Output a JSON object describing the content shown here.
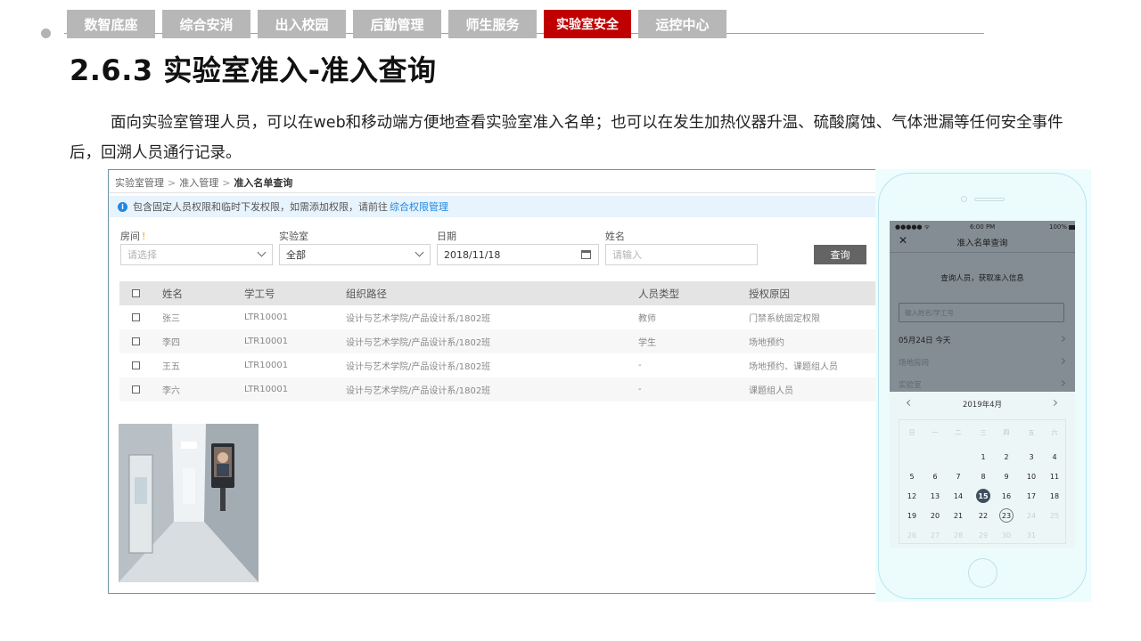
{
  "nav": {
    "tabs": [
      {
        "label": "数智底座"
      },
      {
        "label": "综合安消"
      },
      {
        "label": "出入校园"
      },
      {
        "label": "后勤管理"
      },
      {
        "label": "师生服务"
      },
      {
        "label": "实验室安全"
      },
      {
        "label": "运控中心"
      }
    ],
    "active_index": 5,
    "active_color": "#c00000",
    "tab_color": "#b7b7b7"
  },
  "slide": {
    "title": "2.6.3 实验室准入-准入查询",
    "description": "面向实验室管理人员，可以在web和移动端方便地查看实验室准入名单；也可以在发生加热仪器升温、硫酸腐蚀、气体泄漏等任何安全事件后，回溯人员通行记录。"
  },
  "desktop": {
    "breadcrumb": [
      "实验室管理",
      "准入管理",
      "准入名单查询"
    ],
    "notice": {
      "text": "包含固定人员权限和临时下发权限，如需添加权限，请前往",
      "link": "综合权限管理"
    },
    "filters": {
      "room": {
        "label": "房间",
        "placeholder": "请选择"
      },
      "lab": {
        "label": "实验室",
        "value": "全部"
      },
      "date": {
        "label": "日期",
        "value": "2018/11/18"
      },
      "name": {
        "label": "姓名",
        "placeholder": "请输入"
      }
    },
    "query_button": "查询",
    "table": {
      "columns": [
        "姓名",
        "学工号",
        "组织路径",
        "人员类型",
        "授权原因"
      ],
      "rows": [
        {
          "name": "张三",
          "id": "LTR10001",
          "org": "设计与艺术学院/产品设计系/1802班",
          "type": "教师",
          "reason": "门禁系统固定权限"
        },
        {
          "name": "李四",
          "id": "LTR10001",
          "org": "设计与艺术学院/产品设计系/1802班",
          "type": "学生",
          "reason": "场地预约"
        },
        {
          "name": "王五",
          "id": "LTR10001",
          "org": "设计与艺术学院/产品设计系/1802班",
          "type": "-",
          "reason": "场地预约、课题组人员"
        },
        {
          "name": "李六",
          "id": "LTR10001",
          "org": "设计与艺术学院/产品设计系/1802班",
          "type": "-",
          "reason": "课题组人员"
        }
      ]
    }
  },
  "mobile": {
    "status": {
      "signal": "●●●●● ᯤ",
      "time": "6:00 PM",
      "battery": "100%"
    },
    "title": "准入名单查询",
    "hint": "查询人员，获取准入信息",
    "search_placeholder": "输入姓名/学工号",
    "date_row": "05月24日  今天",
    "room_row": "场地房间",
    "lab_row": "实验室",
    "calendar": {
      "month": "2019年4月",
      "weekdays": [
        "日",
        "一",
        "二",
        "三",
        "四",
        "五",
        "六"
      ],
      "today": 15,
      "selected": 23
    }
  }
}
